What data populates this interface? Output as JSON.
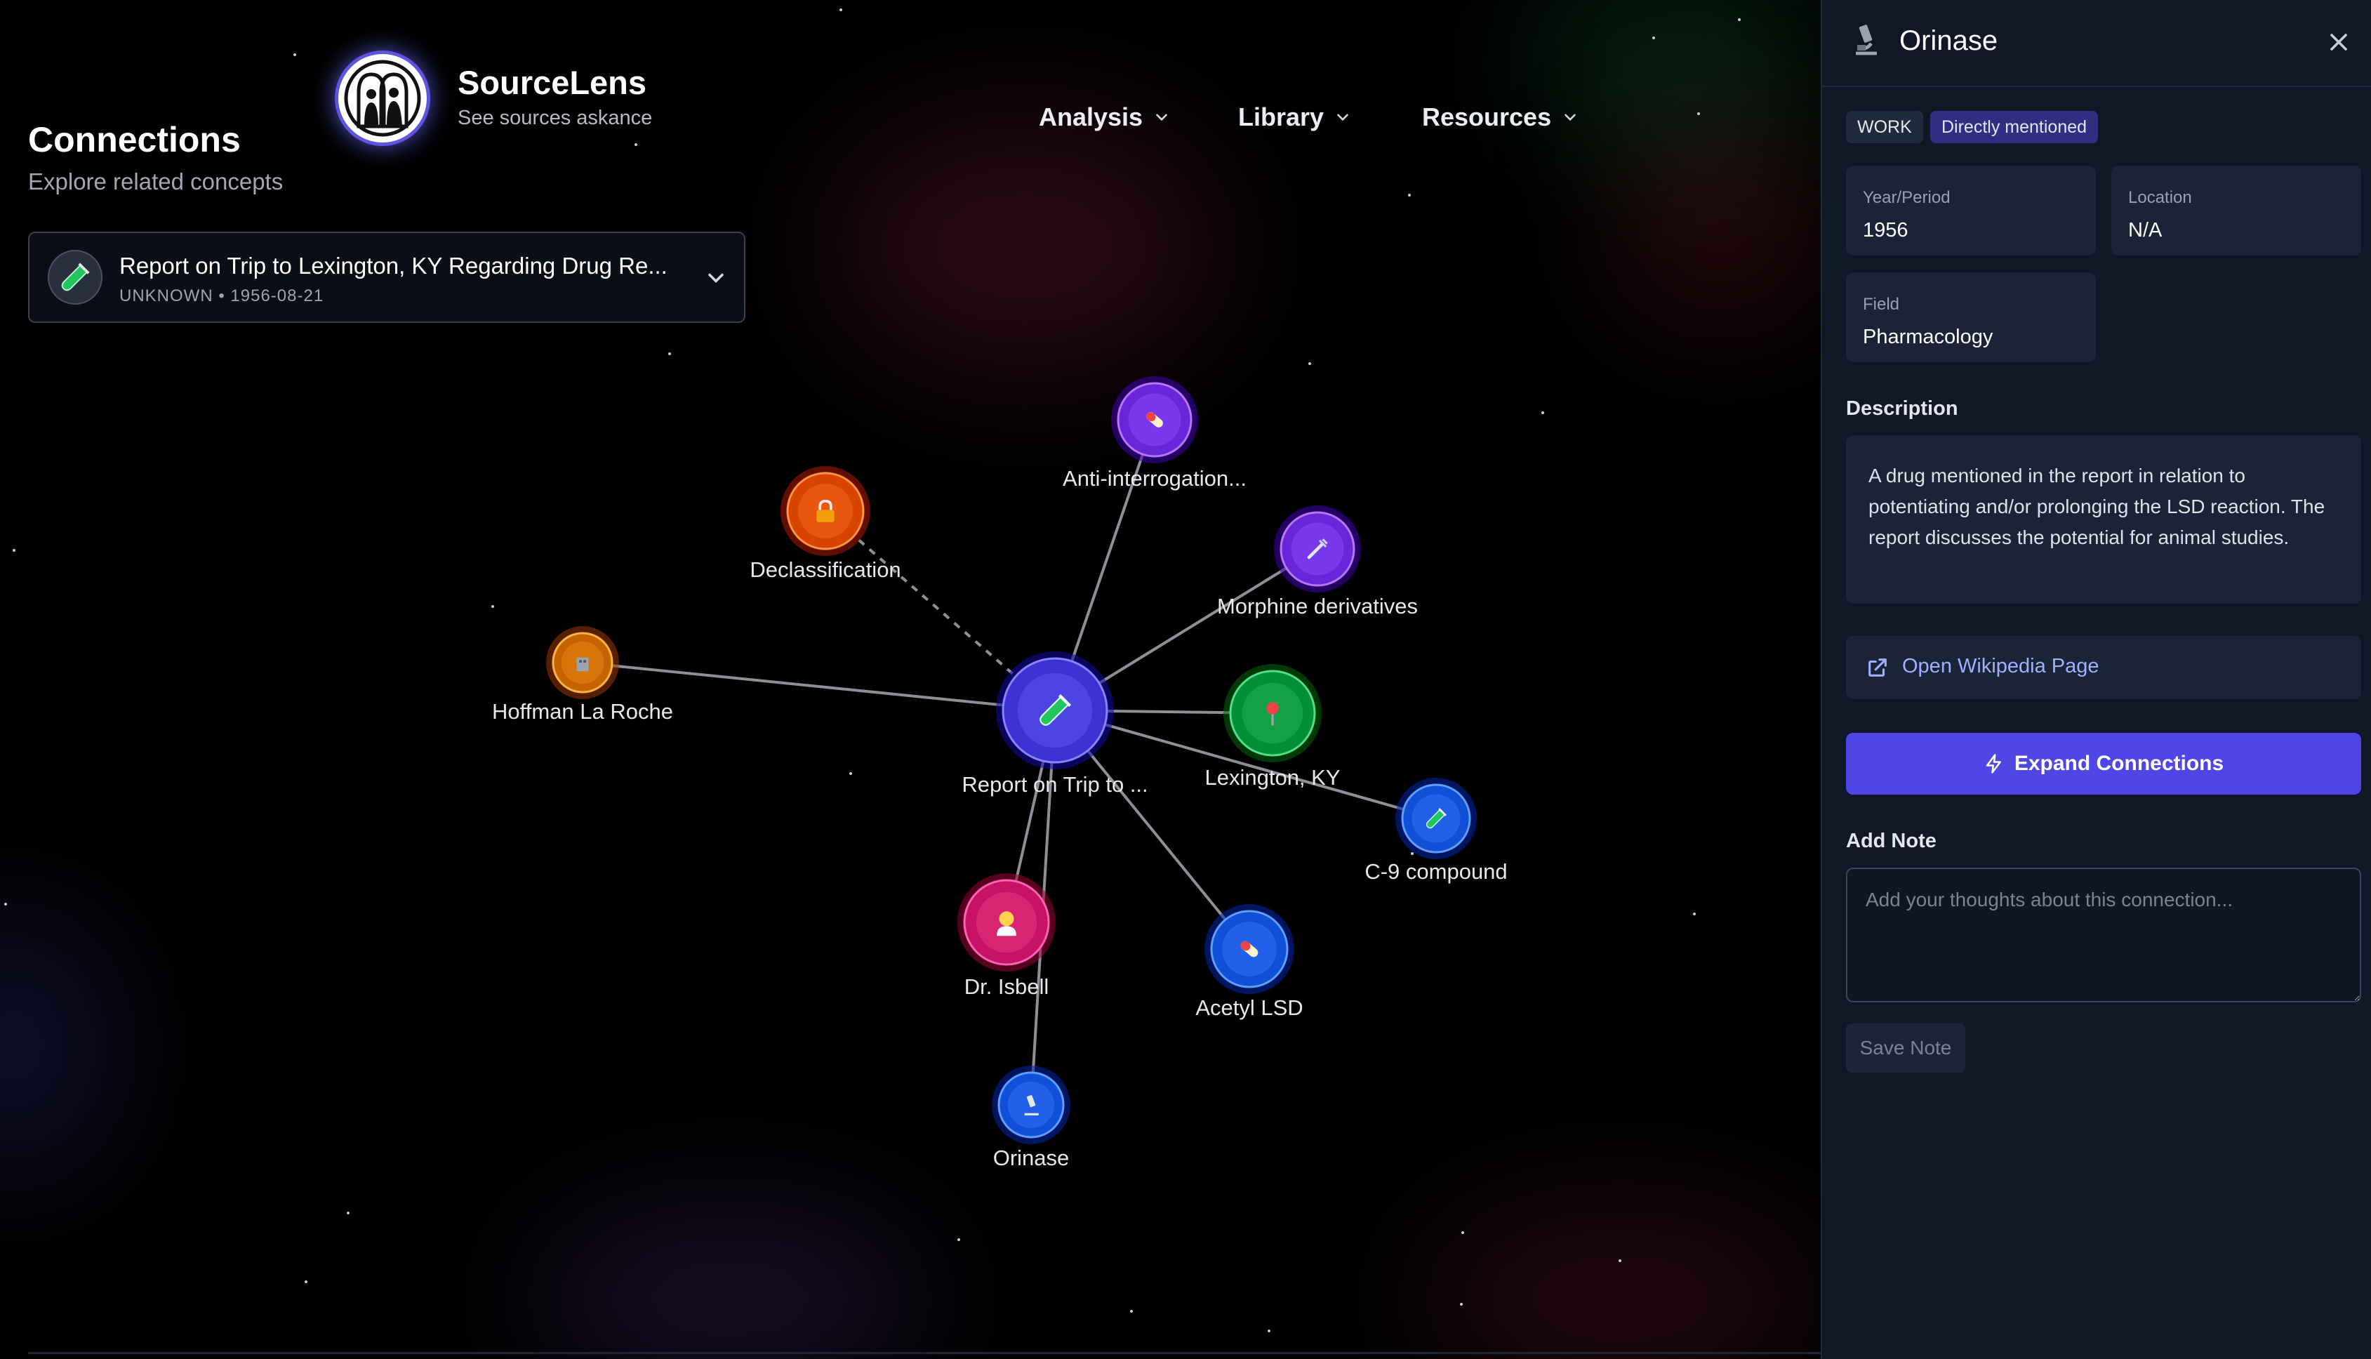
{
  "brand": {
    "name": "SourceLens",
    "tagline": "See sources askance"
  },
  "page": {
    "title": "Connections",
    "subtitle": "Explore related concepts"
  },
  "nav": [
    {
      "label": "Analysis"
    },
    {
      "label": "Library"
    },
    {
      "label": "Resources"
    }
  ],
  "document_selector": {
    "title": "Report on Trip to Lexington, KY Regarding Drug Re...",
    "type": "UNKNOWN",
    "separator": "•",
    "date": "1956-08-21",
    "icon": "test-tube-icon"
  },
  "graph": {
    "center": {
      "label": "Report on Trip to ...",
      "icon": "test-tube-icon",
      "color": "#4f46e5"
    },
    "nodes": [
      {
        "id": "anti",
        "label": "Anti-interrogation...",
        "icon": "pill-icon",
        "color": "#7c3aed"
      },
      {
        "id": "declass",
        "label": "Declassification",
        "icon": "lock-icon",
        "color": "#ea580c"
      },
      {
        "id": "morphine",
        "label": "Morphine derivatives",
        "icon": "syringe-icon",
        "color": "#7c3aed"
      },
      {
        "id": "hoffman",
        "label": "Hoffman La Roche",
        "icon": "building-icon",
        "color": "#d97706"
      },
      {
        "id": "lexington",
        "label": "Lexington, KY",
        "icon": "pin-icon",
        "color": "#16a34a"
      },
      {
        "id": "c9",
        "label": "C-9 compound",
        "icon": "test-tube-icon",
        "color": "#2563eb"
      },
      {
        "id": "isbell",
        "label": "Dr. Isbell",
        "icon": "scientist-icon",
        "color": "#db2777"
      },
      {
        "id": "acetyl",
        "label": "Acetyl LSD",
        "icon": "pill-icon",
        "color": "#2563eb"
      },
      {
        "id": "orinase",
        "label": "Orinase",
        "icon": "microscope-icon",
        "color": "#2563eb"
      }
    ]
  },
  "panel": {
    "title": "Orinase",
    "icon": "microscope-icon",
    "tags": [
      "WORK",
      "Directly mentioned"
    ],
    "fields": [
      {
        "label": "Year/Period",
        "value": "1956"
      },
      {
        "label": "Location",
        "value": "N/A"
      },
      {
        "label": "Field",
        "value": "Pharmacology"
      }
    ],
    "description_heading": "Description",
    "description": "A drug mentioned in the report in relation to potentiating and/or prolonging the LSD reaction. The report discusses the potential for animal studies.",
    "wiki_label": "Open Wikipedia Page",
    "expand_label": "Expand Connections",
    "note_heading": "Add Note",
    "note_placeholder": "Add your thoughts about this connection...",
    "save_label": "Save Note"
  },
  "colors": {
    "accent": "#4f46e5",
    "panel_bg": "#101827",
    "tag_highlight": "#312e81"
  }
}
